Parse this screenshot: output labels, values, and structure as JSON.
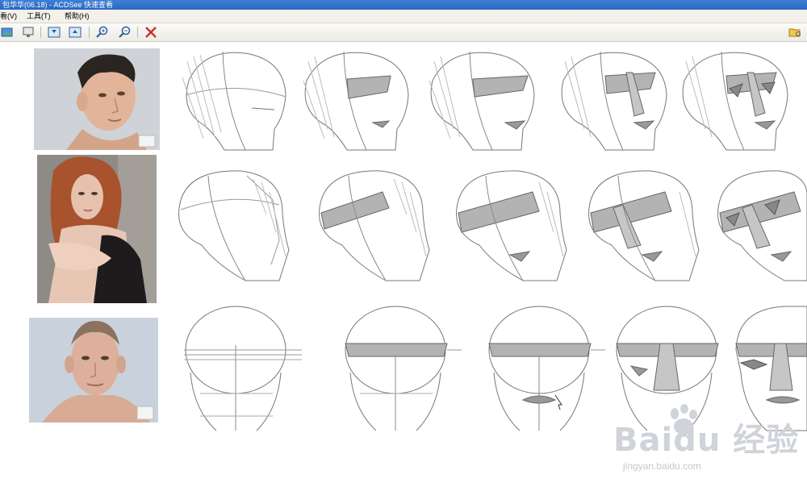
{
  "window": {
    "title": "包华华(06.18) - ACDSee 快速查看"
  },
  "menu": {
    "items": [
      "看(V)",
      "工具(T)",
      "帮助(H)"
    ]
  },
  "toolbar": {
    "buttons": [
      {
        "name": "browse-icon"
      },
      {
        "name": "full-screen-icon"
      },
      {
        "name": "previous-icon"
      },
      {
        "name": "next-icon"
      },
      {
        "name": "zoom-in-icon"
      },
      {
        "name": "zoom-out-icon"
      },
      {
        "name": "delete-icon"
      }
    ],
    "accent": "#c8312a"
  },
  "watermark": {
    "brand": "Baidu 经验",
    "url": "jingyan.baidu.com"
  }
}
